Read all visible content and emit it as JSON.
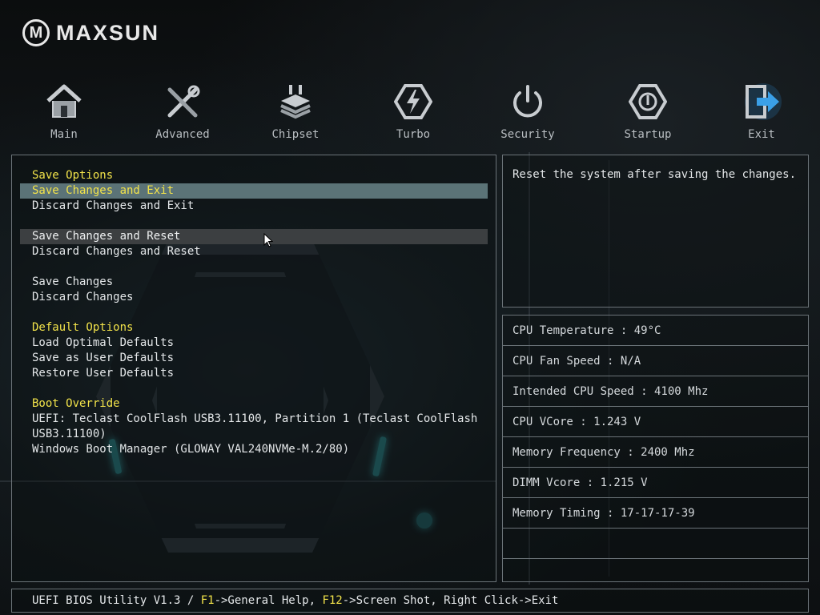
{
  "logo": {
    "mark": "M",
    "text": "MAXSUN"
  },
  "nav": [
    {
      "label": "Main",
      "icon": "home-icon"
    },
    {
      "label": "Advanced",
      "icon": "tools-icon"
    },
    {
      "label": "Chipset",
      "icon": "chip-icon"
    },
    {
      "label": "Turbo",
      "icon": "turbo-icon"
    },
    {
      "label": "Security",
      "icon": "power-icon"
    },
    {
      "label": "Startup",
      "icon": "startup-icon"
    },
    {
      "label": "Exit",
      "icon": "exit-icon"
    }
  ],
  "menu": {
    "save_options": "Save Options",
    "save_changes_and_exit": "Save Changes and Exit",
    "discard_changes_and_exit": "Discard Changes and Exit",
    "save_changes_and_reset": "Save Changes and Reset",
    "discard_changes_and_reset": "Discard Changes and Reset",
    "save_changes": "Save Changes",
    "discard_changes": "Discard Changes",
    "default_options": "Default Options",
    "load_optimal_defaults": "Load Optimal Defaults",
    "save_as_user_defaults": "Save as User Defaults",
    "restore_user_defaults": "Restore User Defaults",
    "boot_override": "Boot Override",
    "boot_uefi_line1": "UEFI: Teclast CoolFlash USB3.11100, Partition 1 (Teclast CoolFlash",
    "boot_uefi_line2": "USB3.11100)",
    "boot_windows": "Windows Boot Manager (GLOWAY VAL240NVMe-M.2/80)"
  },
  "help": "Reset the system after saving the changes.",
  "info": {
    "cpu_temp": "CPU Temperature : 49°C",
    "cpu_fan": "CPU Fan Speed : N/A",
    "cpu_speed": "Intended CPU Speed : 4100 Mhz",
    "cpu_vcore": "CPU VCore : 1.243 V",
    "mem_freq": "Memory Frequency : 2400 Mhz",
    "dimm_vcore": "DIMM Vcore : 1.215 V",
    "mem_timing": "Memory Timing : 17-17-17-39"
  },
  "footer": {
    "prefix": "UEFI BIOS Utility V1.3 / ",
    "f1_key": "F1",
    "f1_text": "->General Help, ",
    "f12_key": "F12",
    "f12_text": "->Screen Shot, Right Click->Exit"
  },
  "colors": {
    "section": "#f2e34a",
    "selected_bg": "#5b7377",
    "hover_bg": "#3c3f41",
    "accent": "#2b8a8f"
  }
}
